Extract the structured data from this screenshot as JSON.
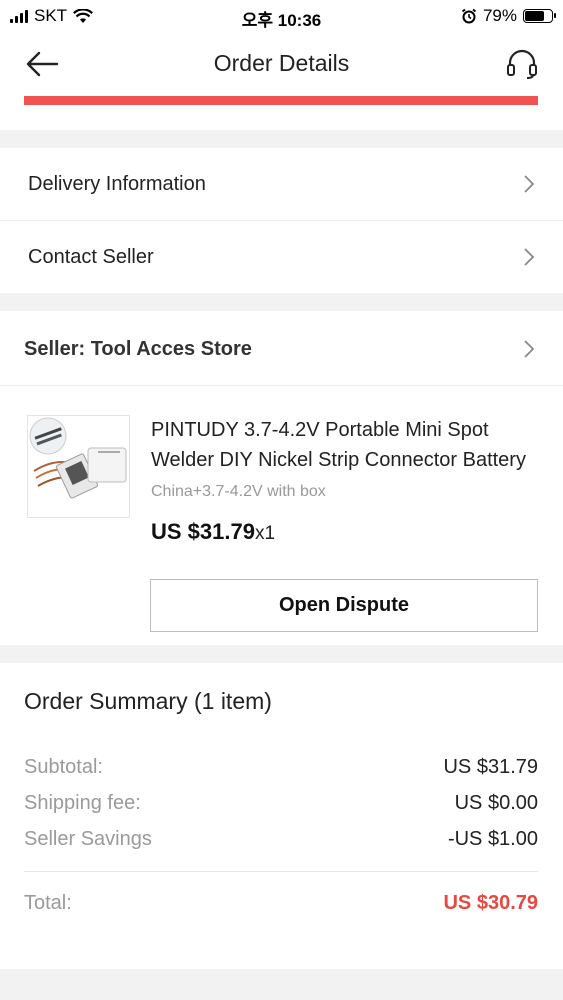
{
  "status_bar": {
    "carrier": "SKT",
    "time": "오후 10:36",
    "battery": "79%",
    "battery_level": 0.79
  },
  "header": {
    "title": "Order Details",
    "back_icon": "back-arrow-icon",
    "support_icon": "headset-icon",
    "accent_color": "#f15353"
  },
  "menu": {
    "delivery_info": "Delivery Information",
    "contact_seller": "Contact Seller"
  },
  "seller": {
    "label": "Seller: Tool Acces Store"
  },
  "product": {
    "name": "PINTUDY 3.7-4.2V Portable Mini Spot Welder DIY Nickel Strip Connector Battery",
    "variant": "China+3.7-4.2V with box",
    "price": "US $31.79",
    "quantity": "x1"
  },
  "actions": {
    "open_dispute": "Open Dispute"
  },
  "summary": {
    "title": "Order Summary (1 item)",
    "subtotal_label": "Subtotal:",
    "subtotal_value": "US $31.79",
    "shipping_label": "Shipping fee:",
    "shipping_value": "US $0.00",
    "savings_label": "Seller Savings",
    "savings_value": "-US $1.00",
    "total_label": "Total:",
    "total_value": "US $30.79",
    "total_color": "#e9473f"
  }
}
